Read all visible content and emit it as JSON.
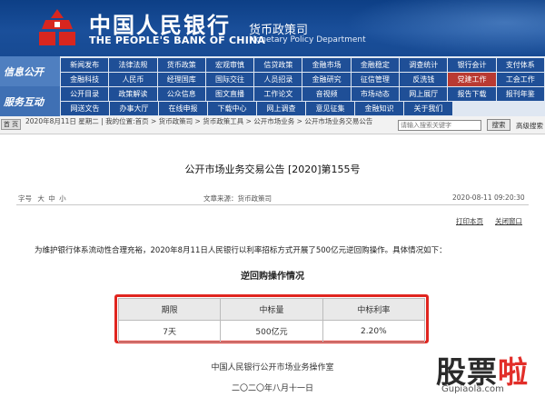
{
  "header": {
    "bank_cn": "中国人民银行",
    "bank_en": "THE PEOPLE'S BANK OF CHINA",
    "dept_cn": "货币政策司",
    "dept_en": "Monetary Policy Department"
  },
  "nav": {
    "section1": "信息公开",
    "section2": "服务互动",
    "rows": [
      [
        {
          "label": "新闻发布",
          "alt": false
        },
        {
          "label": "法律法规",
          "alt": false
        },
        {
          "label": "货币政策",
          "alt": false
        },
        {
          "label": "宏观审慎",
          "alt": false
        },
        {
          "label": "信贷政策",
          "alt": false
        },
        {
          "label": "金融市场",
          "alt": false
        },
        {
          "label": "金融稳定",
          "alt": false
        },
        {
          "label": "调查统计",
          "alt": false
        },
        {
          "label": "银行会计",
          "alt": false
        },
        {
          "label": "支付体系",
          "alt": false
        }
      ],
      [
        {
          "label": "金融科技",
          "alt": false
        },
        {
          "label": "人民币",
          "alt": false
        },
        {
          "label": "经理国库",
          "alt": false
        },
        {
          "label": "国际交往",
          "alt": false
        },
        {
          "label": "人员招录",
          "alt": false
        },
        {
          "label": "金融研究",
          "alt": false
        },
        {
          "label": "征信管理",
          "alt": false
        },
        {
          "label": "反洗钱",
          "alt": false
        },
        {
          "label": "党建工作",
          "alt": true
        },
        {
          "label": "工会工作",
          "alt": false
        }
      ],
      [
        {
          "label": "公开目录",
          "alt": false
        },
        {
          "label": "政策解读",
          "alt": false
        },
        {
          "label": "公众信息",
          "alt": false
        },
        {
          "label": "图文直播",
          "alt": false
        },
        {
          "label": "工作论文",
          "alt": false
        },
        {
          "label": "音视频",
          "alt": false
        },
        {
          "label": "市场动态",
          "alt": false
        },
        {
          "label": "网上展厅",
          "alt": false
        },
        {
          "label": "报告下载",
          "alt": false
        },
        {
          "label": "报刊年鉴",
          "alt": false
        }
      ],
      [
        {
          "label": "网送文告",
          "alt": false
        },
        {
          "label": "办事大厅",
          "alt": false
        },
        {
          "label": "在线申报",
          "alt": false
        },
        {
          "label": "下载中心",
          "alt": false
        },
        {
          "label": "网上调查",
          "alt": false
        },
        {
          "label": "意见征集",
          "alt": false
        },
        {
          "label": "金融知识",
          "alt": false
        },
        {
          "label": "关于我们",
          "alt": false
        }
      ]
    ]
  },
  "breadcrumb": {
    "home": "首 页",
    "text": "2020年8月11日 星期二 | 我的位置:首页 > 货币政策司 > 货币政策工具 > 公开市场业务 > 公开市场业务交易公告",
    "search_placeholder": "请输入搜索关键字",
    "search_button": "搜索",
    "advanced": "高级搜索"
  },
  "article": {
    "title": "公开市场业务交易公告 [2020]第155号",
    "font_label": "字号",
    "font_sizes": [
      "大",
      "中",
      "小"
    ],
    "source_label": "文章来源：",
    "source": "货币政策司",
    "datetime": "2020-08-11 09:20:30",
    "print": "打印本页",
    "close": "关闭窗口",
    "intro": "为维护银行体系流动性合理充裕，2020年8月11日人民银行以利率招标方式开展了500亿元逆回购操作。具体情况如下：",
    "section_title": "逆回购操作情况",
    "table": {
      "headers": [
        "期限",
        "中标量",
        "中标利率"
      ],
      "rows": [
        [
          "7天",
          "500亿元",
          "2.20%"
        ]
      ]
    },
    "org": "中国人民银行公开市场业务操作室",
    "date": "二〇二〇年八月十一日"
  },
  "watermark": {
    "part1": "股票",
    "part2": "啦",
    "url": "Gupiaola.com"
  },
  "colors": {
    "header_blue": "#0d3f86",
    "nav_blue": "#1f4f97",
    "nav_red": "#b93a32",
    "highlight_red": "#e0251f"
  }
}
